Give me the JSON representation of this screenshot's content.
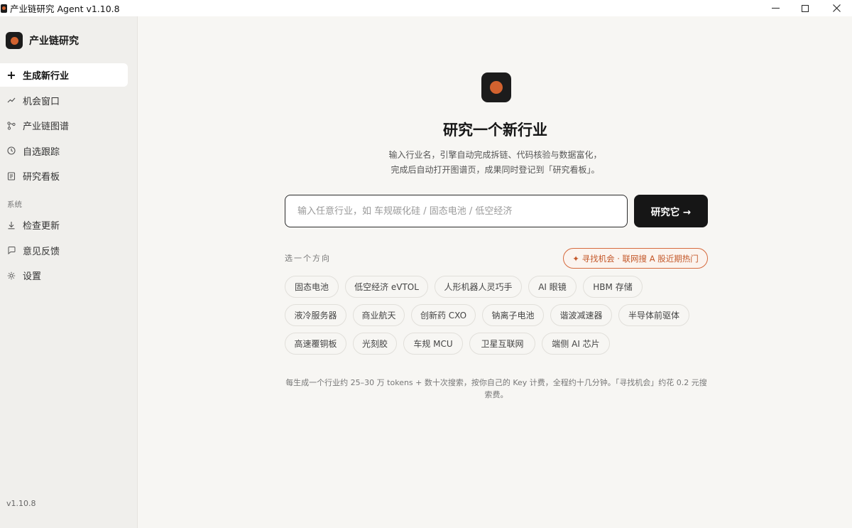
{
  "titlebar": {
    "title": "产业链研究 Agent  v1.10.8"
  },
  "sidebar": {
    "brand": "产业链研究",
    "items": [
      {
        "label": "生成新行业",
        "icon": "plus-icon",
        "active": true
      },
      {
        "label": "机会窗口",
        "icon": "trend-line-icon"
      },
      {
        "label": "产业链图谱",
        "icon": "graph-nodes-icon"
      },
      {
        "label": "自选跟踪",
        "icon": "clock-icon"
      },
      {
        "label": "研究看板",
        "icon": "board-icon"
      }
    ],
    "section_label": "系统",
    "system_items": [
      {
        "label": "检查更新",
        "icon": "download-icon"
      },
      {
        "label": "意见反馈",
        "icon": "chat-bubble-icon"
      },
      {
        "label": "设置",
        "icon": "gear-icon"
      }
    ],
    "version": "v1.10.8"
  },
  "hero": {
    "title": "研究一个新行业",
    "subtitle_line1": "输入行业名，引擎自动完成拆链、代码核验与数据富化，",
    "subtitle_line2": "完成后自动打开图谱页，成果同时登记到「研究看板」。"
  },
  "search": {
    "placeholder": "输入任意行业，如 车规碳化硅 / 固态电池 / 低空经济",
    "value": "",
    "button_label": "研究它 →"
  },
  "directions": {
    "label": "选一个方向",
    "opportunity_button": "✦ 寻找机会 · 联网搜 A 股近期热门",
    "rows": [
      [
        "固态电池",
        "低空经济 eVTOL",
        "人形机器人灵巧手",
        "AI 眼镜",
        "HBM 存储"
      ],
      [
        "液冷服务器",
        "商业航天",
        "创新药 CXO",
        "钠离子电池",
        "谐波减速器",
        "半导体前驱体"
      ],
      [
        "高速覆铜板",
        "光刻胶",
        "车规 MCU",
        "卫星互联网",
        "端侧 AI 芯片"
      ]
    ]
  },
  "footnote": "每生成一个行业约 25–30 万 tokens + 数十次搜索，按你自己的 Key 计费，全程约十几分钟。「寻找机会」约花 0.2 元搜索费。",
  "colors": {
    "accent": "#d2622f",
    "dark": "#161616",
    "background": "#f7f6f3",
    "sidebar": "#f0efec"
  }
}
